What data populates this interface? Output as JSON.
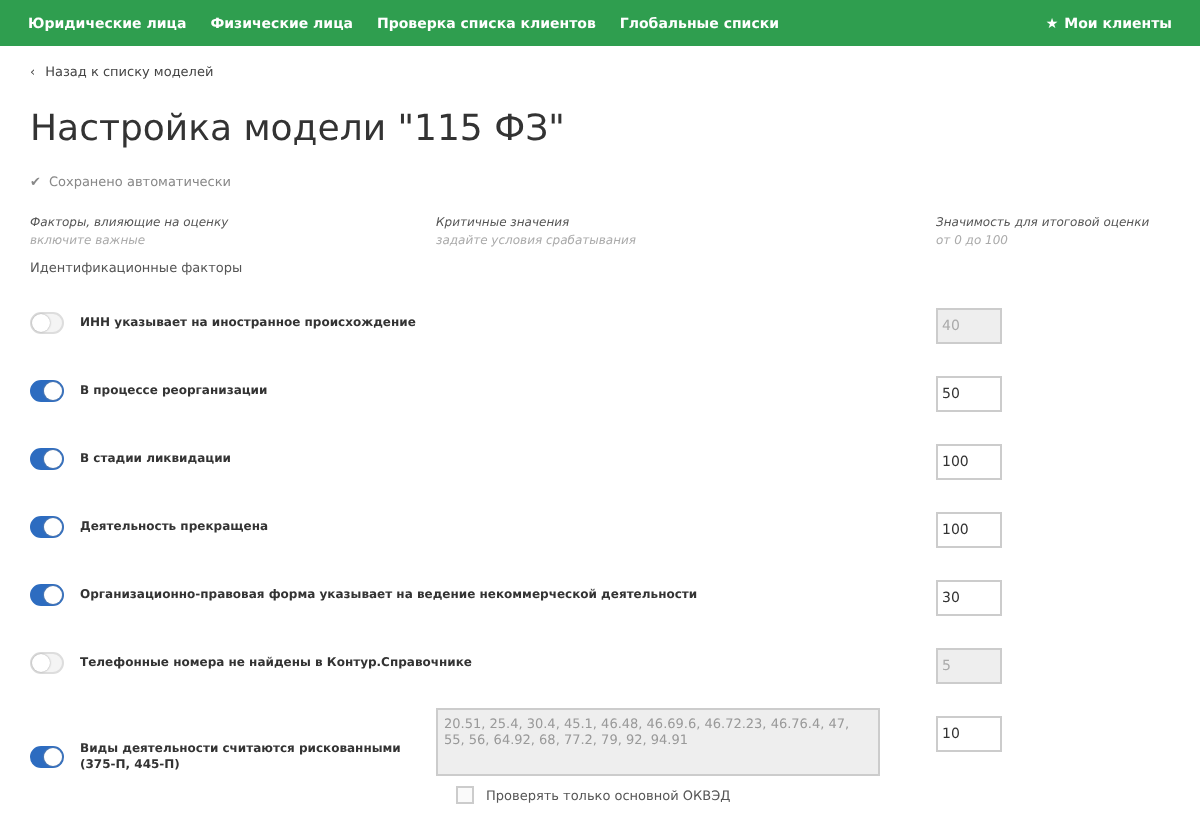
{
  "nav": {
    "items": [
      {
        "label": "Юридические лица"
      },
      {
        "label": "Физические лица"
      },
      {
        "label": "Проверка списка клиентов"
      },
      {
        "label": "Глобальные списки"
      }
    ],
    "right": {
      "icon": "★",
      "label": "Мои клиенты"
    }
  },
  "back_link": {
    "icon": "‹",
    "label": "Назад к списку моделей"
  },
  "title": "Настройка модели \"115 ФЗ\"",
  "save_status": {
    "icon": "✔",
    "label": "Сохранено автоматически"
  },
  "columns": [
    {
      "title": "Факторы, влияющие на оценку",
      "hint": "включите важные"
    },
    {
      "title": "Критичные значения",
      "hint": "задайте условия срабатывания"
    },
    {
      "title": "Значимость для итоговой оценки",
      "hint": "от 0 до 100"
    }
  ],
  "section": "Идентификационные факторы",
  "factors": [
    {
      "label": "ИНН указывает на иностранное происхождение",
      "on": false,
      "weight": "40"
    },
    {
      "label": "В процессе реорганизации",
      "on": true,
      "weight": "50"
    },
    {
      "label": "В стадии ликвидации",
      "on": true,
      "weight": "100"
    },
    {
      "label": "Деятельность прекращена",
      "on": true,
      "weight": "100"
    },
    {
      "label": "Организационно-правовая форма указывает на ведение некоммерческой деятельности",
      "on": true,
      "weight": "30"
    },
    {
      "label": "Телефонные номера не найдены в Контур.Справочнике",
      "on": false,
      "weight": "5"
    },
    {
      "label": "Виды деятельности считаются рискованными (375-П, 445-П)",
      "on": true,
      "weight": "10",
      "criteria": {
        "value": "20.51, 25.4, 30.4, 45.1, 46.48, 46.69.6, 46.72.23, 46.76.4, 47, 55, 56, 64.92, 68, 77.2, 79, 92, 94.91",
        "checkbox": {
          "label": "Проверять только основной ОКВЭД",
          "checked": false
        }
      }
    }
  ]
}
